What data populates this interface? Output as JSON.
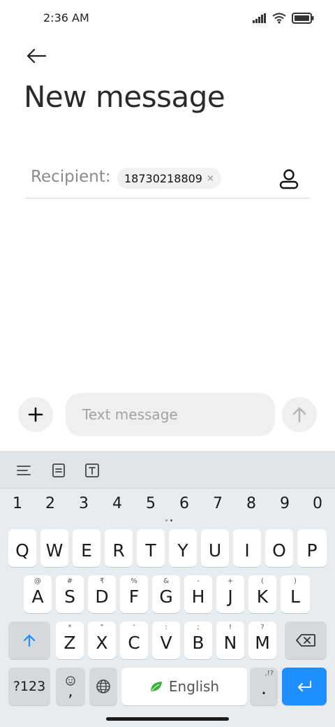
{
  "status_bar": {
    "time": "2:36 AM"
  },
  "header": {
    "title": "New message"
  },
  "recipient": {
    "label": "Recipient:",
    "chip": "18730218809",
    "remove": "×"
  },
  "compose": {
    "placeholder": "Text message"
  },
  "keyboard": {
    "numbers": [
      "1",
      "2",
      "3",
      "4",
      "5",
      "6",
      "7",
      "8",
      "9",
      "0"
    ],
    "row1": [
      {
        "key": "Q",
        "hint": ""
      },
      {
        "key": "W",
        "hint": ""
      },
      {
        "key": "E",
        "hint": ""
      },
      {
        "key": "R",
        "hint": ""
      },
      {
        "key": "T",
        "hint": ""
      },
      {
        "key": "Y",
        "hint": ""
      },
      {
        "key": "U",
        "hint": ""
      },
      {
        "key": "I",
        "hint": ""
      },
      {
        "key": "O",
        "hint": ""
      },
      {
        "key": "P",
        "hint": ""
      }
    ],
    "row2": [
      {
        "key": "A",
        "hint": "@"
      },
      {
        "key": "S",
        "hint": "#"
      },
      {
        "key": "D",
        "hint": "₹"
      },
      {
        "key": "F",
        "hint": "%"
      },
      {
        "key": "G",
        "hint": "&"
      },
      {
        "key": "H",
        "hint": "-"
      },
      {
        "key": "J",
        "hint": "+"
      },
      {
        "key": "K",
        "hint": "("
      },
      {
        "key": "L",
        "hint": ")"
      }
    ],
    "row3": [
      {
        "key": "Z",
        "hint": "*"
      },
      {
        "key": "X",
        "hint": "\""
      },
      {
        "key": "C",
        "hint": "'"
      },
      {
        "key": "V",
        "hint": ":"
      },
      {
        "key": "B",
        "hint": ";"
      },
      {
        "key": "N",
        "hint": "!"
      },
      {
        "key": "M",
        "hint": "?"
      }
    ],
    "symbols_label": "?123",
    "comma": ",",
    "space_label": "English",
    "period": ".",
    "period_hint": ",!?"
  },
  "colors": {
    "accent": "#1f8fff",
    "leaf": "#3cb043"
  }
}
